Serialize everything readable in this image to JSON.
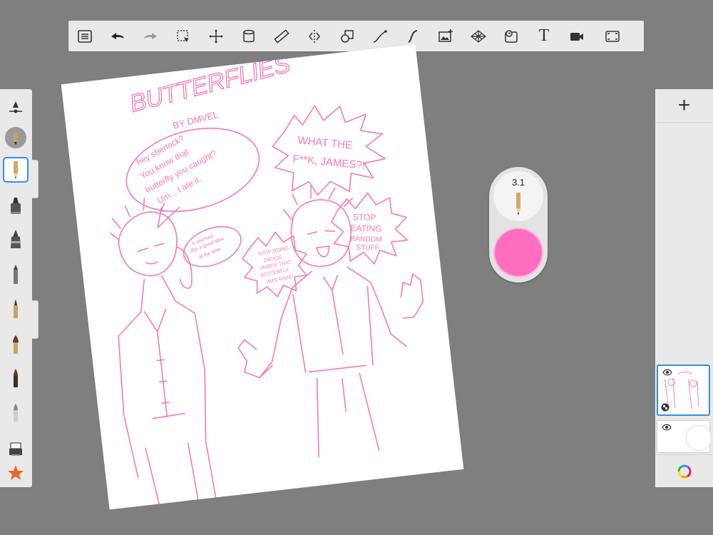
{
  "toolbar": {
    "tools": [
      "list-icon",
      "undo-icon",
      "redo-icon",
      "selection-icon",
      "transform-icon",
      "fill-icon",
      "ruler-icon",
      "symmetry-icon",
      "shapes-icon",
      "curve-icon",
      "steady-stroke-icon",
      "import-image-icon",
      "perspective-grid-icon",
      "time-lapse-icon",
      "text-icon",
      "record-icon",
      "fullscreen-icon"
    ],
    "text_tool_label": "T"
  },
  "brush_palette": {
    "brushes": [
      "brush-settings-icon",
      "brush-eraser-icon",
      "pencil-icon",
      "marker-icon",
      "fountain-pen-icon",
      "airbrush-icon",
      "ink-pen-icon",
      "paintbrush-icon",
      "calligraphy-brush-icon",
      "smudge-icon",
      "brush-library-icon",
      "favorites-star-icon"
    ],
    "selected": "pencil-icon"
  },
  "brush_puck": {
    "size": "3.1",
    "color": "#ff6ebe"
  },
  "layers_panel": {
    "add_label": "+",
    "layers": [
      "layer-1-sketch",
      "layer-2-background"
    ],
    "selected_layer": "layer-1-sketch"
  },
  "drawing": {
    "title": "BUTTERFLIES",
    "byline": "BY DMVEL",
    "bubble_1": [
      "hey sherlock?",
      "You know that",
      "butterfly you caught?",
      "Um... I ate it."
    ],
    "bubble_2": [
      "It seemed",
      "like a good idea",
      "at the time"
    ],
    "bubble_3": [
      "WHAT THE",
      "F**K, JAMES?!"
    ],
    "bubble_4": [
      "STOP DOING",
      "DRUGS,",
      "JAMES! THAT",
      "BUTTERFLY",
      "WAS RARE!"
    ],
    "bubble_5": [
      "STOP",
      "EATING",
      "RANDOM",
      "STUFF"
    ],
    "ink_color": "#f07ab8"
  }
}
